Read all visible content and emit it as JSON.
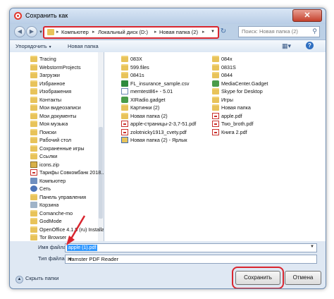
{
  "window": {
    "title": "Сохранить как",
    "close_glyph": "✕"
  },
  "address": {
    "crumbs": [
      "Компьютер",
      "Локальный диск (D:)",
      "Новая папка (2)"
    ],
    "search_placeholder": "Поиск: Новая папка (2)"
  },
  "toolbar": {
    "organize": "Упорядочить",
    "new_folder": "Новая папка"
  },
  "sidebar": [
    {
      "label": "Tracing",
      "icon": "folder"
    },
    {
      "label": "WebstormProjects",
      "icon": "folder"
    },
    {
      "label": "Загрузки",
      "icon": "folder"
    },
    {
      "label": "Избранное",
      "icon": "folder"
    },
    {
      "label": "Изображения",
      "icon": "folder"
    },
    {
      "label": "Контакты",
      "icon": "folder"
    },
    {
      "label": "Мои видеозаписи",
      "icon": "folder"
    },
    {
      "label": "Мои документы",
      "icon": "folder"
    },
    {
      "label": "Моя музыка",
      "icon": "folder"
    },
    {
      "label": "Поиски",
      "icon": "folder"
    },
    {
      "label": "Рабочий стол",
      "icon": "folder"
    },
    {
      "label": "Сохраненные игры",
      "icon": "folder"
    },
    {
      "label": "Ссылки",
      "icon": "folder"
    },
    {
      "label": "icons.zip",
      "icon": "zip"
    },
    {
      "label": "Тарифы Совкомбанк 2018...",
      "icon": "pdf"
    },
    {
      "label": "Компьютер",
      "icon": "computer"
    },
    {
      "label": "Сеть",
      "icon": "network"
    },
    {
      "label": "Панель управления",
      "icon": "folder"
    },
    {
      "label": "Корзина",
      "icon": "trash"
    },
    {
      "label": "Comanche-mo",
      "icon": "folder"
    },
    {
      "label": "GodMode",
      "icon": "folder"
    },
    {
      "label": "OpenOffice 4.1.5 (ru) Installatio",
      "icon": "folder"
    },
    {
      "label": "Tor Browser",
      "icon": "folder"
    }
  ],
  "files_col1": [
    {
      "label": "083X",
      "icon": "folder"
    },
    {
      "label": "599.files",
      "icon": "folder"
    },
    {
      "label": "0841s",
      "icon": "folder"
    },
    {
      "label": "FL_insurance_sample.csv",
      "icon": "sheet"
    },
    {
      "label": "memtest86+ - 5.01",
      "icon": "doc"
    },
    {
      "label": "XIRadio.gadget",
      "icon": "gadget"
    },
    {
      "label": "Картинки (2)",
      "icon": "folder"
    },
    {
      "label": "Новая папка (2)",
      "icon": "folder"
    },
    {
      "label": "apple-страницы-2-3,7-51.pdf",
      "icon": "pdf"
    },
    {
      "label": "zolotnicky1913_cvety.pdf",
      "icon": "pdf"
    },
    {
      "label": "Новая папка (2) - Ярлык",
      "icon": "link"
    }
  ],
  "files_col2": [
    {
      "label": "084x",
      "icon": "folder"
    },
    {
      "label": "0831S",
      "icon": "folder"
    },
    {
      "label": "0844",
      "icon": "folder"
    },
    {
      "label": "MediaCenter.Gadget",
      "icon": "gadget"
    },
    {
      "label": "Skype for Desktop",
      "icon": "folder"
    },
    {
      "label": "Игры",
      "icon": "folder"
    },
    {
      "label": "Новая папка",
      "icon": "folder"
    },
    {
      "label": "apple.pdf",
      "icon": "pdf"
    },
    {
      "label": "Two_broth.pdf",
      "icon": "pdf"
    },
    {
      "label": "Книга 2.pdf",
      "icon": "pdf"
    }
  ],
  "bottom": {
    "filename_label": "Имя файла:",
    "filename_value": "apple (1).pdf",
    "filetype_label": "Тип файла:",
    "filetype_value": "Hamster PDF Reader",
    "hide_folders": "Скрыть папки",
    "save": "Сохранить",
    "cancel": "Отмена"
  }
}
